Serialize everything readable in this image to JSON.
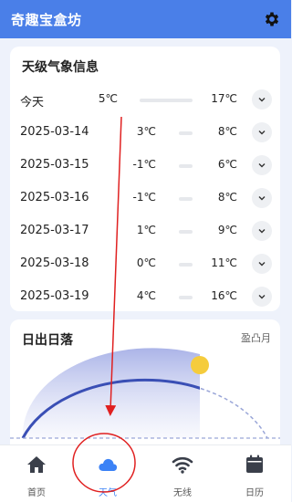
{
  "app": {
    "title": "奇趣宝盒坊"
  },
  "weather": {
    "title": "天级气象信息",
    "rows": [
      {
        "date": "今天",
        "low": "5℃",
        "high": "17℃"
      },
      {
        "date": "2025-03-14",
        "low": "3℃",
        "high": "8℃"
      },
      {
        "date": "2025-03-15",
        "low": "-1℃",
        "high": "6℃"
      },
      {
        "date": "2025-03-16",
        "low": "-1℃",
        "high": "8℃"
      },
      {
        "date": "2025-03-17",
        "low": "1℃",
        "high": "9℃"
      },
      {
        "date": "2025-03-18",
        "low": "0℃",
        "high": "11℃"
      },
      {
        "date": "2025-03-19",
        "low": "4℃",
        "high": "16℃"
      }
    ]
  },
  "sun": {
    "title": "日出日落",
    "moon_phase": "盈凸月"
  },
  "nav": {
    "items": [
      {
        "label": "首页",
        "icon": "home-icon"
      },
      {
        "label": "天气",
        "icon": "cloud-icon"
      },
      {
        "label": "无线",
        "icon": "wifi-icon"
      },
      {
        "label": "日历",
        "icon": "calendar-icon"
      }
    ],
    "active": "天气"
  },
  "colors": {
    "header": "#4a7fe8",
    "accent": "#3b82f6",
    "annotation": "#e02020",
    "sun": "#f5cc3d",
    "arc": "#3a4fb5"
  }
}
